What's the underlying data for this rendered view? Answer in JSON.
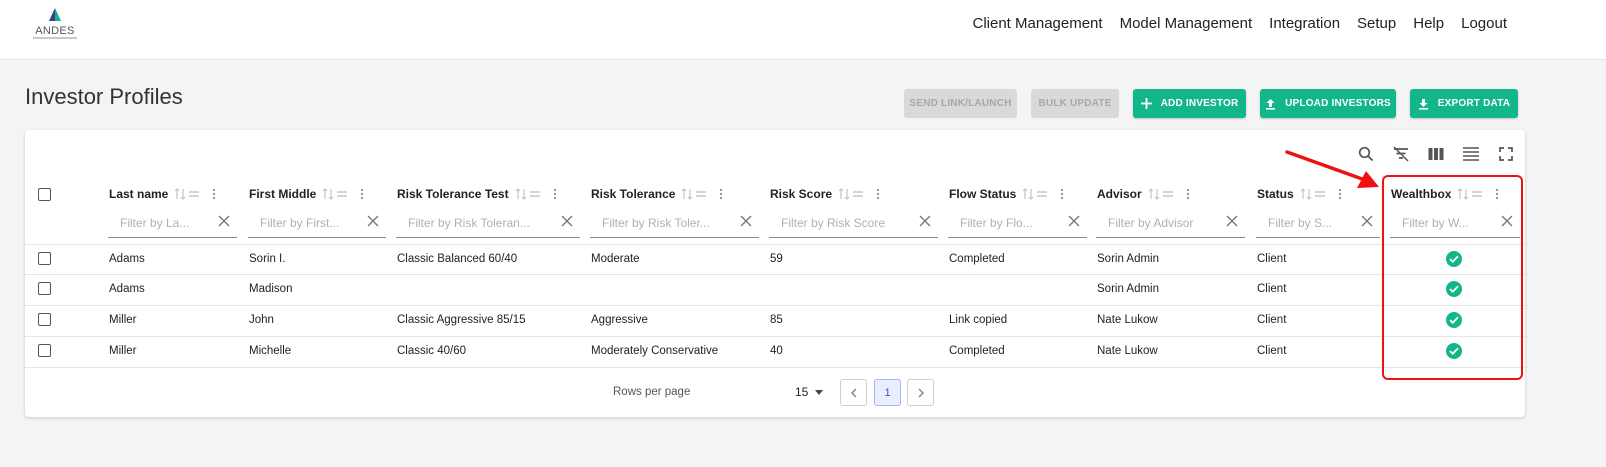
{
  "brand": {
    "name": "ANDES",
    "accent": "#13b68a",
    "logo_mark_colors": [
      "#3a3f8f",
      "#13b68a"
    ]
  },
  "nav": [
    "Client Management",
    "Model Management",
    "Integration",
    "Setup",
    "Help",
    "Logout"
  ],
  "page_title": "Investor Profiles",
  "actions": {
    "send_link": "SEND LINK/LAUNCH",
    "bulk_update": "BULK UPDATE",
    "add_investor": "ADD INVESTOR",
    "upload_investors": "UPLOAD INVESTORS",
    "export_data": "EXPORT DATA"
  },
  "toolbar_icons": [
    "search-icon",
    "filter-off-icon",
    "columns-icon",
    "density-icon",
    "fullscreen-icon"
  ],
  "columns": [
    {
      "label": "Last name",
      "filter_placeholder": "Filter by La..."
    },
    {
      "label": "First Middle",
      "filter_placeholder": "Filter by First..."
    },
    {
      "label": "Risk Tolerance Test",
      "filter_placeholder": "Filter by Risk Toleran..."
    },
    {
      "label": "Risk Tolerance",
      "filter_placeholder": "Filter by Risk Toler..."
    },
    {
      "label": "Risk Score",
      "filter_placeholder": "Filter by Risk Score"
    },
    {
      "label": "Flow Status",
      "filter_placeholder": "Filter by Flo..."
    },
    {
      "label": "Advisor",
      "filter_placeholder": "Filter by Advisor"
    },
    {
      "label": "Status",
      "filter_placeholder": "Filter by S..."
    },
    {
      "label": "Wealthbox",
      "filter_placeholder": "Filter by W..."
    }
  ],
  "rows": [
    {
      "last": "Adams",
      "first": "Sorin I.",
      "test": "Classic Balanced 60/40",
      "tolerance": "Moderate",
      "score": "59",
      "flow": "Completed",
      "advisor": "Sorin Admin",
      "status": "Client",
      "wealthbox": true
    },
    {
      "last": "Adams",
      "first": "Madison",
      "test": "",
      "tolerance": "",
      "score": "",
      "flow": "",
      "advisor": "Sorin Admin",
      "status": "Client",
      "wealthbox": true
    },
    {
      "last": "Miller",
      "first": "John",
      "test": "Classic Aggressive 85/15",
      "tolerance": "Aggressive",
      "score": "85",
      "flow": "Link copied",
      "advisor": "Nate Lukow",
      "status": "Client",
      "wealthbox": true
    },
    {
      "last": "Miller",
      "first": "Michelle",
      "test": "Classic 40/60",
      "tolerance": "Moderately Conservative",
      "score": "40",
      "flow": "Completed",
      "advisor": "Nate Lukow",
      "status": "Client",
      "wealthbox": true
    }
  ],
  "pagination": {
    "rows_per_page_label": "Rows per page",
    "rows_per_page": "15",
    "current_page": "1"
  },
  "annotation": {
    "color": "#f01010"
  }
}
